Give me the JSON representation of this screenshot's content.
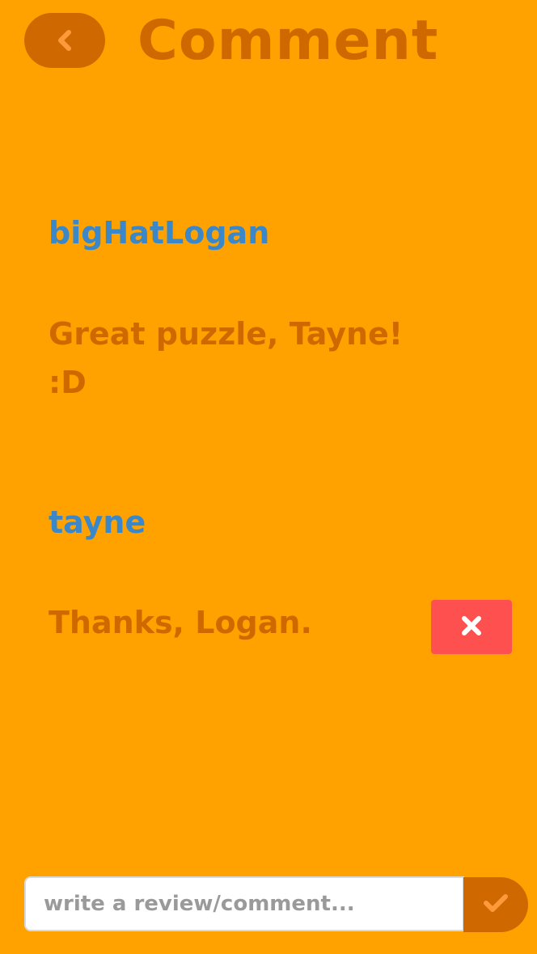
{
  "header": {
    "title": "Comment",
    "back_icon": "chevron-left-icon"
  },
  "comments": [
    {
      "author": "bigHatLogan",
      "text": "Great puzzle, Tayne! :D",
      "deletable": false
    },
    {
      "author": "tayne",
      "text": "Thanks, Logan.",
      "deletable": true,
      "delete_icon": "close-icon"
    }
  ],
  "composer": {
    "placeholder": "write a review/comment...",
    "value": "",
    "submit_icon": "checkmark-icon"
  },
  "colors": {
    "background": "#FFA200",
    "accent_dark": "#D06800",
    "author": "#3A87C9",
    "delete": "#FF5050",
    "chevron": "#FF9A3C"
  }
}
